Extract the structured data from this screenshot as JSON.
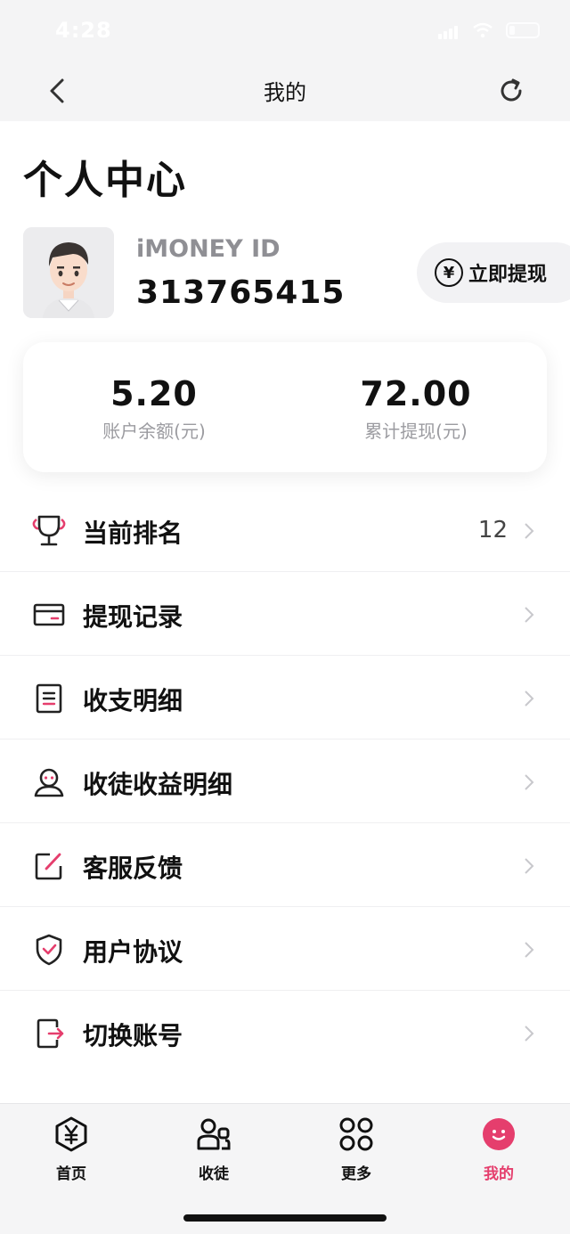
{
  "status_bar": {
    "time": "4:28"
  },
  "nav": {
    "title": "我的"
  },
  "page_heading": "个人中心",
  "profile": {
    "id_label": "iMONEY ID",
    "id_value": "313765415",
    "withdraw_icon": "yen-circle-icon",
    "withdraw_label": "立即提现"
  },
  "stats": [
    {
      "value": "5.20",
      "label": "账户余额(元)"
    },
    {
      "value": "72.00",
      "label": "累计提现(元)"
    }
  ],
  "menu": [
    {
      "icon": "trophy-icon",
      "label": "当前排名",
      "value": "12"
    },
    {
      "icon": "card-icon",
      "label": "提现记录",
      "value": ""
    },
    {
      "icon": "document-icon",
      "label": "收支明细",
      "value": ""
    },
    {
      "icon": "user-icon",
      "label": "收徒收益明细",
      "value": ""
    },
    {
      "icon": "edit-icon",
      "label": "客服反馈",
      "value": ""
    },
    {
      "icon": "shield-check-icon",
      "label": "用户协议",
      "value": ""
    },
    {
      "icon": "logout-icon",
      "label": "切换账号",
      "value": ""
    }
  ],
  "tabs": [
    {
      "icon": "yen-hexagon-icon",
      "label": "首页"
    },
    {
      "icon": "users-icon",
      "label": "收徒"
    },
    {
      "icon": "grid-icon",
      "label": "更多"
    },
    {
      "icon": "smile-icon",
      "label": "我的"
    }
  ],
  "colors": {
    "accent": "#e53e6d",
    "text": "#111111",
    "muted": "#9b9ba0",
    "background": "#f4f4f5"
  }
}
